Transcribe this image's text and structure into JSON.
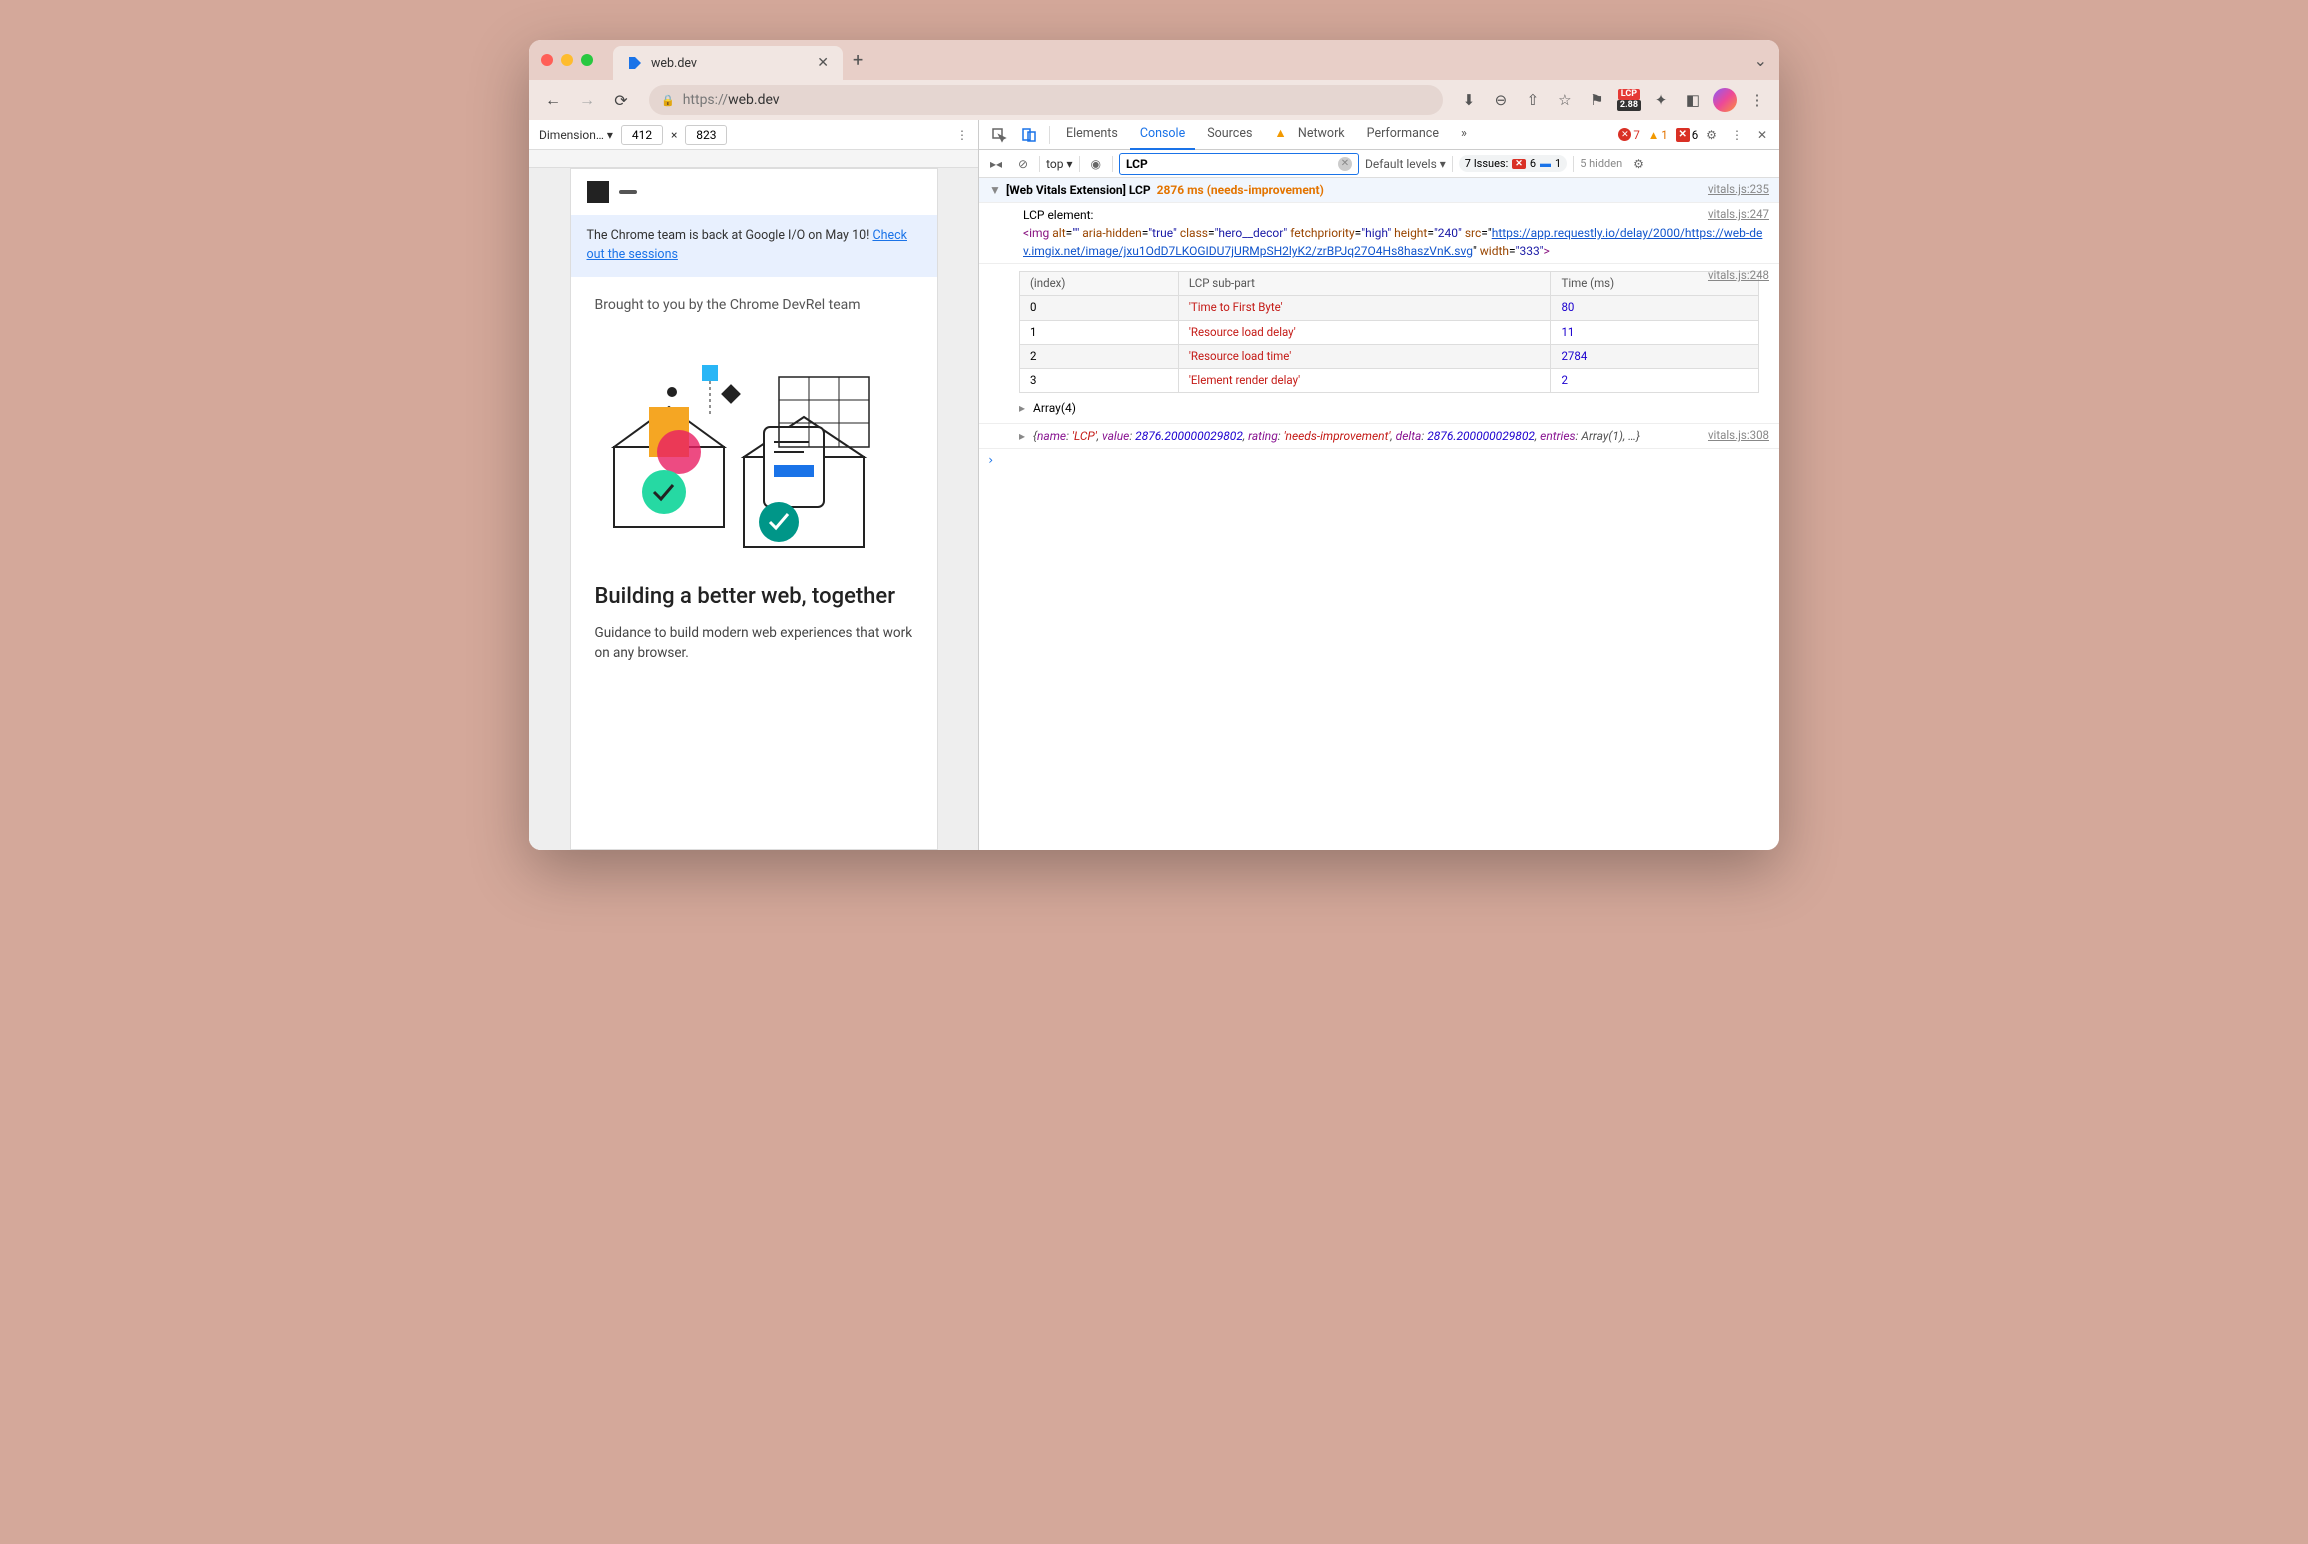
{
  "chrome": {
    "tab_title": "web.dev",
    "url_proto": "https://",
    "url_host": "web.dev",
    "lcp_badge": "LCP",
    "lcp_value": "2.88"
  },
  "device_bar": {
    "dim_label": "Dimension…",
    "width": "412",
    "height": "823"
  },
  "preview": {
    "banner_text": "The Chrome team is back at Google I/O on May 10! ",
    "banner_link": "Check out the sessions",
    "brought": "Brought to you by the Chrome DevRel team",
    "heading": "Building a better web, together",
    "desc": "Guidance to build modern web experiences that work on any browser."
  },
  "devtools": {
    "tabs": [
      "Elements",
      "Console",
      "Sources",
      "Network",
      "Performance"
    ],
    "active_tab": "Console",
    "err_count": "7",
    "warn_count": "1",
    "blocked_count": "6",
    "scope": "top",
    "filter": "LCP",
    "levels": "Default levels",
    "issues_label": "7 Issues:",
    "issues_err": "6",
    "issues_info": "1",
    "hidden": "5 hidden"
  },
  "console": {
    "line1_prefix": "[Web Vitals Extension] LCP",
    "line1_ms": "2876 ms",
    "line1_status": "(needs-improvement)",
    "src1": "vitals.js:235",
    "line2": "LCP element:",
    "src2": "vitals.js:247",
    "html_tag_open": "<img",
    "html_attrs": [
      {
        "n": "alt",
        "q": "\"\"",
        "link": false
      },
      {
        "n": "aria-hidden",
        "q": "\"true\"",
        "link": false
      },
      {
        "n": "class",
        "q": "\"hero__decor\"",
        "link": false
      },
      {
        "n": "fetchpriority",
        "q": "\"high\"",
        "link": false
      },
      {
        "n": "height",
        "q": "\"240\"",
        "link": false
      }
    ],
    "html_src_attr": "src",
    "html_src_url": "https://app.requestly.io/delay/2000/https://web-dev.imgix.net/image/jxu1OdD7LKOGIDU7jURMpSH2lyK2/zrBPJq27O4Hs8haszVnK.svg",
    "html_width": "\"333\"",
    "html_close": ">",
    "src3": "vitals.js:248",
    "table_headers": [
      "(index)",
      "LCP sub-part",
      "Time (ms)"
    ],
    "table_rows": [
      {
        "i": "0",
        "part": "'Time to First Byte'",
        "ms": "80"
      },
      {
        "i": "1",
        "part": "'Resource load delay'",
        "ms": "11"
      },
      {
        "i": "2",
        "part": "'Resource load time'",
        "ms": "2784"
      },
      {
        "i": "3",
        "part": "'Element render delay'",
        "ms": "2"
      }
    ],
    "array_label": "Array(4)",
    "src4": "vitals.js:308",
    "obj_name": "name",
    "obj_name_v": "'LCP'",
    "obj_value": "value",
    "obj_value_v": "2876.200000029802",
    "obj_rating": "rating",
    "obj_rating_v": "'needs-improvement'",
    "obj_delta": "delta",
    "obj_delta_v": "2876.200000029802",
    "obj_entries": "entries",
    "obj_entries_v": "Array(1)",
    "obj_more": ", …}"
  }
}
